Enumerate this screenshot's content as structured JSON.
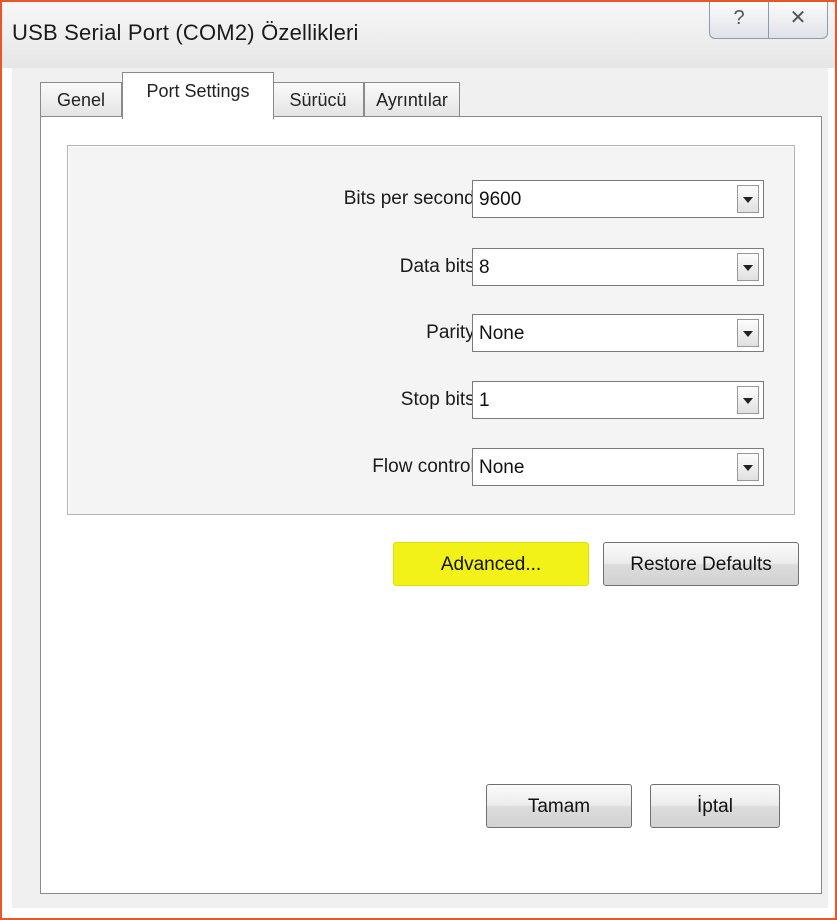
{
  "window": {
    "title": "USB Serial Port (COM2) Özellikleri",
    "help_icon": "question-mark-icon",
    "close_icon": "close-x-icon",
    "help_glyph": "?",
    "close_glyph": "✕"
  },
  "tabs": [
    {
      "label": "Genel",
      "active": false
    },
    {
      "label": "Port Settings",
      "active": true
    },
    {
      "label": "Sürücü",
      "active": false
    },
    {
      "label": "Ayrıntılar",
      "active": false
    }
  ],
  "settings": [
    {
      "label": "Bits per second:",
      "value": "9600"
    },
    {
      "label": "Data bits:",
      "value": "8"
    },
    {
      "label": "Parity:",
      "value": "None"
    },
    {
      "label": "Stop bits:",
      "value": "1"
    },
    {
      "label": "Flow control:",
      "value": "None"
    }
  ],
  "buttons": {
    "advanced": "Advanced...",
    "restore_defaults": "Restore Defaults",
    "ok": "Tamam",
    "cancel": "İptal"
  },
  "colors": {
    "window_border": "#e8562a",
    "advanced_highlight": "#f2f218"
  }
}
